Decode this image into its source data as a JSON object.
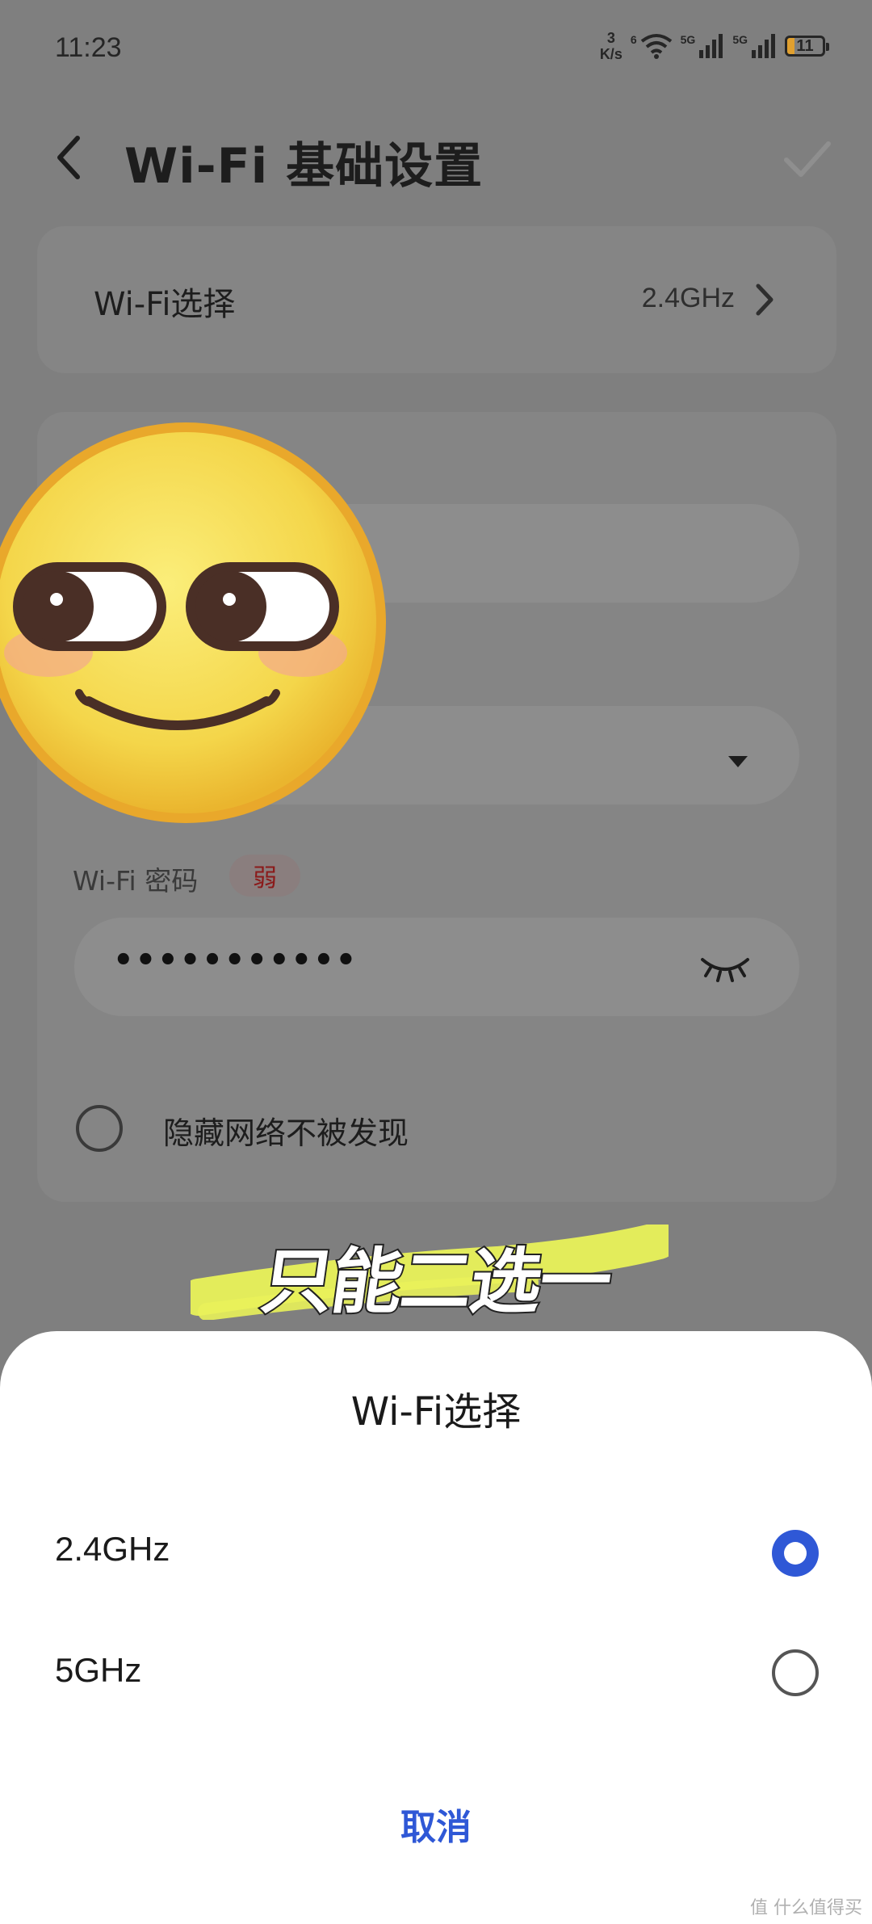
{
  "status_bar": {
    "time": "11:23",
    "speed_value": "3",
    "speed_unit": "K/s",
    "wifi_tag": "6",
    "net1": "5G",
    "net2": "5G",
    "battery": "11"
  },
  "header": {
    "title": "Wi-Fi 基础设置",
    "back_icon": "chevron-left-icon",
    "confirm_icon": "checkmark-icon"
  },
  "wifi_select": {
    "label": "Wi-Fi选择",
    "value": "2.4GHz"
  },
  "password": {
    "label": "Wi-Fi 密码",
    "strength": "弱",
    "value": "•••••••••••",
    "toggle_icon": "eye-closed-icon"
  },
  "hide_network": {
    "label": "隐藏网络不被发现",
    "checked": false
  },
  "caption": "只能二选一",
  "sheet": {
    "title": "Wi-Fi选择",
    "options": [
      {
        "label": "2.4GHz",
        "selected": true
      },
      {
        "label": "5GHz",
        "selected": false
      }
    ],
    "cancel": "取消"
  },
  "watermark": "值 什么值得买",
  "colors": {
    "accent": "#2f58d6",
    "overlay": "#7f7f7f",
    "strength_weak": "#8b1a1a",
    "emoji_yellow": "#f6dc55",
    "caption_highlight": "#e9f25a"
  }
}
